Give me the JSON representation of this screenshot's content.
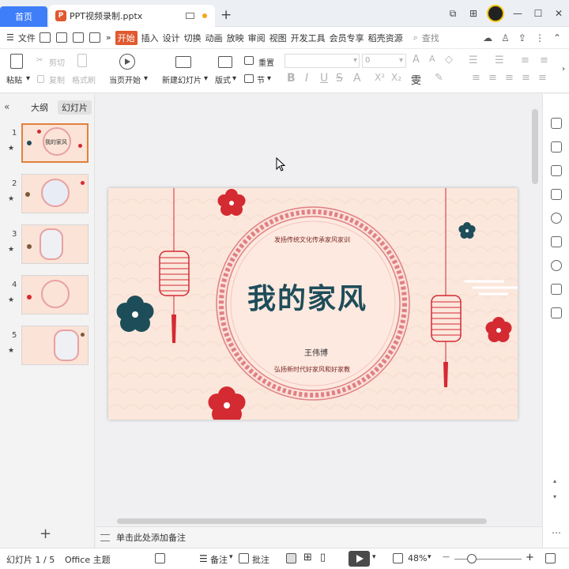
{
  "titlebar": {
    "home_tab": "首页",
    "doc_tab": "PPT视频录制.pptx",
    "doc_icon": "P",
    "new_tab": "+"
  },
  "menubar": {
    "file": "文件",
    "items": [
      "开始",
      "插入",
      "设计",
      "切换",
      "动画",
      "放映",
      "审阅",
      "视图",
      "开发工具",
      "会员专享",
      "稻壳资源"
    ],
    "search": "查找"
  },
  "ribbon": {
    "paste": "粘贴",
    "cut": "剪切",
    "copy": "复制",
    "format_painter": "格式刷",
    "play_from_current": "当页开始",
    "new_slide": "新建幻灯片",
    "layout": "版式",
    "section": "节",
    "reset": "重置",
    "font_size": "0"
  },
  "leftpanel": {
    "tab_outline": "大纲",
    "tab_slides": "幻灯片",
    "slides": [
      {
        "num": "1",
        "title": "我的家风"
      },
      {
        "num": "2",
        "title": ""
      },
      {
        "num": "3",
        "title": ""
      },
      {
        "num": "4",
        "title": ""
      },
      {
        "num": "5",
        "title": ""
      }
    ],
    "add": "+"
  },
  "slide": {
    "title": "我的家风",
    "subtitle_top": "发扬传统文化传承家风家训",
    "author": "王伟博",
    "subtitle_bottom": "弘扬新时代好家风和好家教",
    "colors": {
      "background": "#fbe7dc",
      "red": "#d42a32",
      "teal": "#1e4d5a",
      "frame": "#e07f86"
    }
  },
  "notes": {
    "placeholder": "单击此处添加备注"
  },
  "statusbar": {
    "slide_info": "幻灯片 1 / 5",
    "theme": "Office 主题",
    "notes_btn": "备注",
    "comment_btn": "批注",
    "zoom": "48%",
    "minus": "—",
    "plus": "+"
  }
}
